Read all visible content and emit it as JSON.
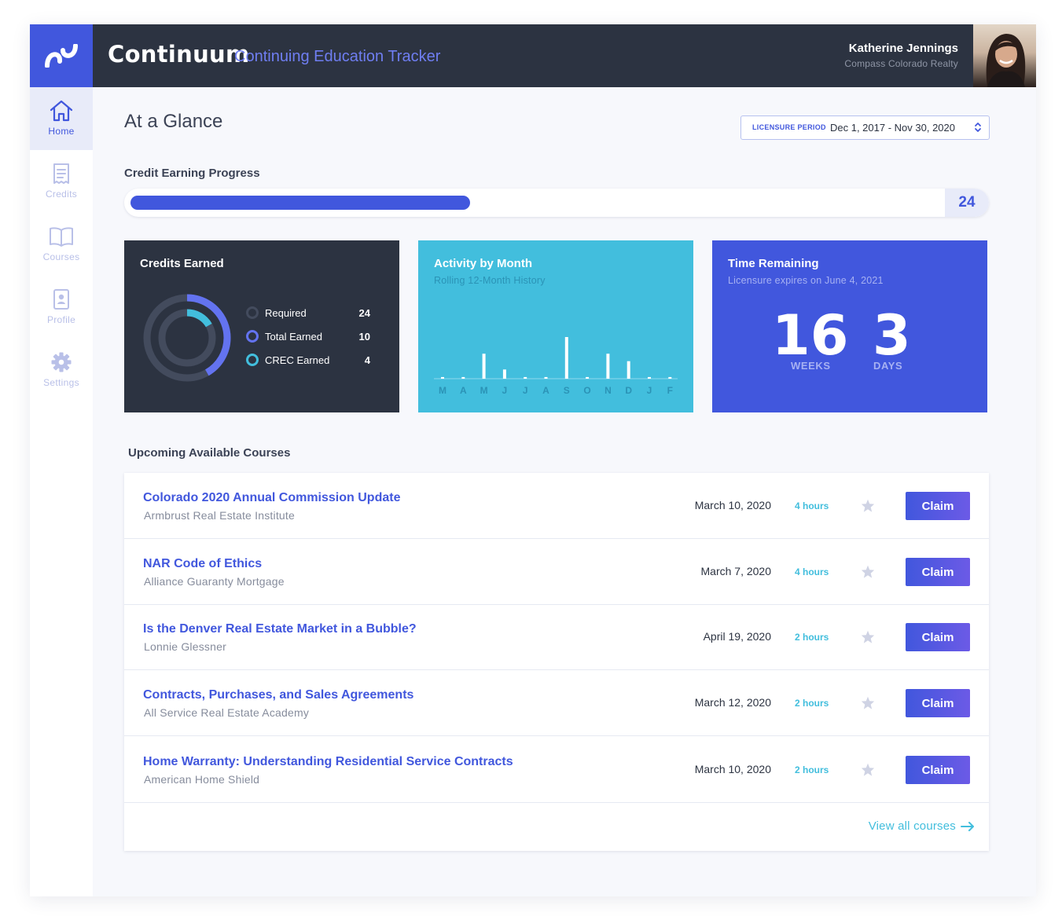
{
  "header": {
    "brand": "Continuum",
    "subtitle": "Continuing Education Tracker",
    "user_name": "Katherine Jennings",
    "user_org": "Compass Colorado Realty"
  },
  "sidebar": {
    "items": [
      {
        "label": "Home",
        "icon": "home-icon",
        "active": true
      },
      {
        "label": "Credits",
        "icon": "receipt-icon",
        "active": false
      },
      {
        "label": "Courses",
        "icon": "book-icon",
        "active": false
      },
      {
        "label": "Profile",
        "icon": "id-badge-icon",
        "active": false
      },
      {
        "label": "Settings",
        "icon": "gear-icon",
        "active": false
      }
    ]
  },
  "main": {
    "title": "At a Glance",
    "licensure": {
      "label": "LICENSURE PERIOD",
      "value": "Dec 1, 2017 - Nov 30, 2020"
    },
    "progress": {
      "title": "Credit Earning Progress",
      "earned": 10,
      "required": 24,
      "end_label": "24"
    }
  },
  "credits_card": {
    "title": "Credits Earned",
    "legend": [
      {
        "label": "Required",
        "value": "24",
        "color": "#434b5d"
      },
      {
        "label": "Total Earned",
        "value": "10",
        "color": "#6373f0"
      },
      {
        "label": "CREC Earned",
        "value": "4",
        "color": "#42bedd"
      }
    ]
  },
  "chart_data": {
    "type": "bar",
    "title": "Activity by Month",
    "subtitle": "Rolling 12-Month History",
    "categories": [
      "M",
      "A",
      "M",
      "J",
      "J",
      "A",
      "S",
      "O",
      "N",
      "D",
      "J",
      "F"
    ],
    "values": [
      0.2,
      0.2,
      3,
      1.1,
      0.2,
      0.2,
      5,
      0.2,
      3,
      2.1,
      0.2,
      0.2
    ],
    "ylim": [
      0,
      5
    ],
    "xlabel": "",
    "ylabel": "",
    "grid": false,
    "legend": "none"
  },
  "time_card": {
    "title": "Time Remaining",
    "subtitle": "Licensure expires on June 4, 2021",
    "weeks": "16",
    "weeks_label": "WEEKS",
    "days": "3",
    "days_label": "DAYS"
  },
  "courses": {
    "heading": "Upcoming Available Courses",
    "claim_label": "Claim",
    "items": [
      {
        "title": "Colorado 2020 Annual Commission Update",
        "provider": "Armbrust Real Estate Institute",
        "date": "March 10, 2020",
        "hours": "4 hours"
      },
      {
        "title": "NAR Code of Ethics",
        "provider": "Alliance Guaranty Mortgage",
        "date": "March 7, 2020",
        "hours": "4 hours"
      },
      {
        "title": "Is the Denver Real Estate Market in a Bubble?",
        "provider": "Lonnie Glessner",
        "date": "April 19, 2020",
        "hours": "2 hours"
      },
      {
        "title": "Contracts, Purchases, and Sales Agreements",
        "provider": "All Service Real Estate Academy",
        "date": "March 12, 2020",
        "hours": "2 hours"
      },
      {
        "title": "Home Warranty: Understanding Residential Service Contracts",
        "provider": "American Home Shield",
        "date": "March 10, 2020",
        "hours": "2 hours"
      }
    ],
    "view_all": "View all courses"
  },
  "colors": {
    "primary": "#4157dd",
    "accent": "#42bedd",
    "dark": "#2c3341"
  }
}
